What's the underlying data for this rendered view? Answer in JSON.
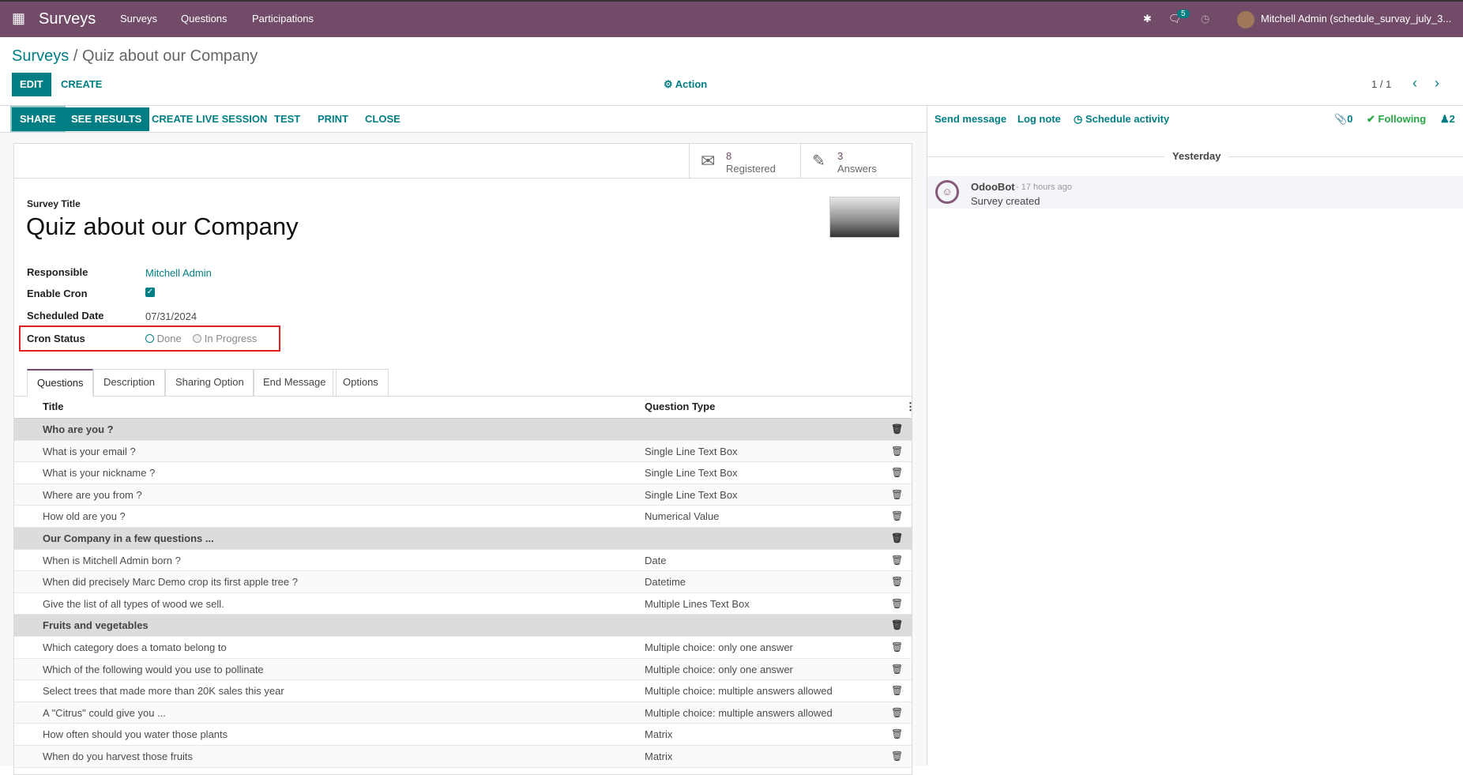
{
  "navbar": {
    "app": "Surveys",
    "menu": [
      "Surveys",
      "Questions",
      "Participations"
    ],
    "chat_badge": "5",
    "user": "Mitchell Admin (schedule_survay_july_3..."
  },
  "breadcrumb": {
    "parent": "Surveys",
    "current": "Quiz about our Company"
  },
  "control": {
    "edit": "EDIT",
    "create": "CREATE",
    "action": "Action",
    "pager": "1 / 1"
  },
  "statusbar": {
    "buttons": [
      "SHARE",
      "SEE RESULTS",
      "CREATE LIVE SESSION",
      "TEST",
      "PRINT",
      "CLOSE"
    ]
  },
  "stats": [
    {
      "value": "8",
      "label": "Registered"
    },
    {
      "value": "3",
      "label": "Answers"
    }
  ],
  "form": {
    "title_label": "Survey Title",
    "title": "Quiz about our Company",
    "fields": {
      "responsible_label": "Responsible",
      "responsible": "Mitchell Admin",
      "cron_label": "Enable Cron",
      "cron_enabled": true,
      "date_label": "Scheduled Date",
      "date": "07/31/2024",
      "status_label": "Cron Status",
      "status_options": [
        "Done",
        "In Progress"
      ]
    }
  },
  "tabs": [
    "Questions",
    "Description",
    "Sharing Option",
    "End Message",
    "Options"
  ],
  "table": {
    "headers": [
      "Title",
      "Question Type"
    ],
    "rows": [
      {
        "title": "Who are you ?",
        "type": "",
        "section": true
      },
      {
        "title": "What is your email ?",
        "type": "Single Line Text Box"
      },
      {
        "title": "What is your nickname ?",
        "type": "Single Line Text Box"
      },
      {
        "title": "Where are you from ?",
        "type": "Single Line Text Box"
      },
      {
        "title": "How old are you ?",
        "type": "Numerical Value"
      },
      {
        "title": "Our Company in a few questions ...",
        "type": "",
        "section": true
      },
      {
        "title": "When is Mitchell Admin born ?",
        "type": "Date"
      },
      {
        "title": "When did precisely Marc Demo crop its first apple tree ?",
        "type": "Datetime"
      },
      {
        "title": "Give the list of all types of wood we sell.",
        "type": "Multiple Lines Text Box"
      },
      {
        "title": "Fruits and vegetables",
        "type": "",
        "section": true
      },
      {
        "title": "Which category does a tomato belong to",
        "type": "Multiple choice: only one answer"
      },
      {
        "title": "Which of the following would you use to pollinate",
        "type": "Multiple choice: only one answer"
      },
      {
        "title": "Select trees that made more than 20K sales this year",
        "type": "Multiple choice: multiple answers allowed"
      },
      {
        "title": "A \"Citrus\" could give you ...",
        "type": "Multiple choice: multiple answers allowed"
      },
      {
        "title": "How often should you water those plants",
        "type": "Matrix"
      },
      {
        "title": "When do you harvest those fruits",
        "type": "Matrix"
      }
    ]
  },
  "chatter": {
    "send": "Send message",
    "log": "Log note",
    "schedule": "Schedule activity",
    "attachments": "0",
    "following": "Following",
    "followers": "2",
    "date_sep": "Yesterday",
    "message": {
      "author": "OdooBot",
      "time": "- 17 hours ago",
      "body": "Survey created"
    }
  }
}
